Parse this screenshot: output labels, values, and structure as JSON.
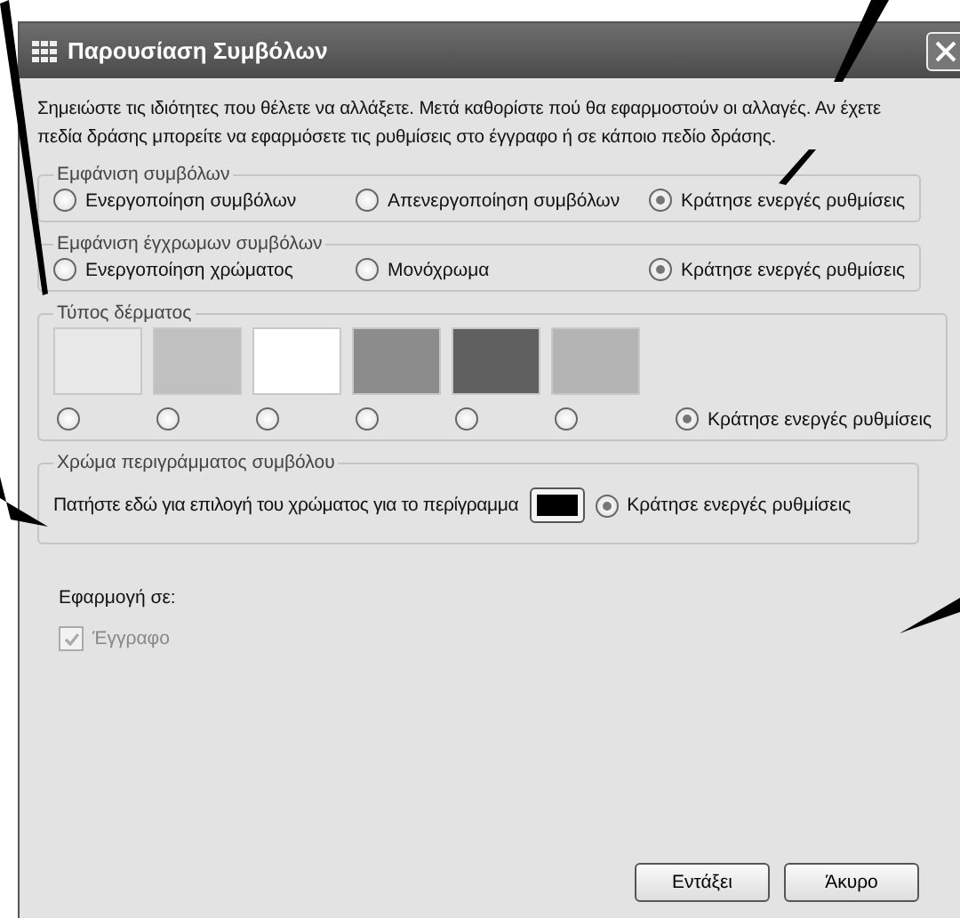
{
  "window": {
    "title": "Παρουσίαση Συμβόλων"
  },
  "description": "Σημειώστε τις ιδιότητες που θέλετε να αλλάξετε.  Μετά καθορίστε πού θα εφαρμοστούν οι αλλαγές. Αν έχετε πεδία δράσης μπορείτε να εφαρμόσετε τις ρυθμίσεις στο έγγραφο ή σε κάποιο πεδίο δράσης.",
  "symbol_display": {
    "legend": "Εμφάνιση συμβόλων",
    "options": [
      {
        "label": "Ενεργοποίηση συμβόλων",
        "selected": false
      },
      {
        "label": "Απενεργοποίηση συμβόλων",
        "selected": false
      },
      {
        "label": "Κράτησε ενεργές ρυθμίσεις",
        "selected": true
      }
    ]
  },
  "color_symbols": {
    "legend": "Εμφάνιση έγχρωμων συμβόλων",
    "options": [
      {
        "label": "Ενεργοποίηση χρώματος",
        "selected": false
      },
      {
        "label": "Μονόχρωμα",
        "selected": false
      },
      {
        "label": "Κράτησε ενεργές ρυθμίσεις",
        "selected": true
      }
    ]
  },
  "skin": {
    "legend": "Τύπος δέρματος",
    "swatches": [
      {
        "color": "#e8e8e8",
        "selected": false
      },
      {
        "color": "#c0c0c0",
        "selected": false
      },
      {
        "color": "#ffffff",
        "selected": false
      },
      {
        "color": "#8c8c8c",
        "selected": false
      },
      {
        "color": "#606060",
        "selected": false
      },
      {
        "color": "#b4b4b4",
        "selected": false
      }
    ],
    "keep": {
      "label": "Κράτησε ενεργές ρυθμίσεις",
      "selected": true
    }
  },
  "outline": {
    "legend": "Χρώμα περιγράμματος συμβόλου",
    "prompt": "Πατήστε εδώ για επιλογή του χρώματος για το περίγραμμα",
    "color": "#000000",
    "keep": {
      "label": "Κράτησε ενεργές ρυθμίσεις",
      "selected": true
    }
  },
  "apply_to": {
    "label": "Εφαρμογή σε:",
    "items": [
      {
        "label": "Έγγραφο",
        "checked": true,
        "disabled": true
      }
    ]
  },
  "buttons": [
    "Εντάξει",
    "Άκυρο"
  ]
}
